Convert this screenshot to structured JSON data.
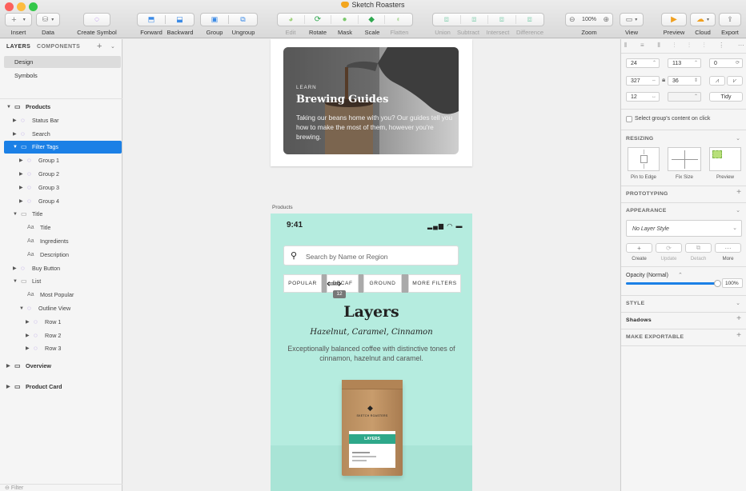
{
  "window": {
    "title": "Sketch Roasters"
  },
  "toolbar": {
    "insert": "Insert",
    "data": "Data",
    "create_symbol": "Create Symbol",
    "forward": "Forward",
    "backward": "Backward",
    "group": "Group",
    "ungroup": "Ungroup",
    "edit": "Edit",
    "rotate": "Rotate",
    "mask": "Mask",
    "scale": "Scale",
    "flatten": "Flatten",
    "union": "Union",
    "subtract": "Subtract",
    "intersect": "Intersect",
    "difference": "Difference",
    "zoom_label": "Zoom",
    "zoom_value": "100%",
    "view": "View",
    "preview": "Preview",
    "cloud": "Cloud",
    "export": "Export"
  },
  "left": {
    "tab_layers": "LAYERS",
    "tab_components": "COMPONENTS",
    "pages": [
      "Design",
      "Symbols"
    ],
    "layers": [
      {
        "label": "Products",
        "depth": 0,
        "kind": "artboard",
        "open": true
      },
      {
        "label": "Status Bar",
        "depth": 1,
        "kind": "symbol",
        "open": false
      },
      {
        "label": "Search",
        "depth": 1,
        "kind": "symbol",
        "open": false
      },
      {
        "label": "Filter Tags",
        "depth": 1,
        "kind": "folder",
        "open": true,
        "selected": true
      },
      {
        "label": "Group 1",
        "depth": 2,
        "kind": "symbol",
        "open": false
      },
      {
        "label": "Group 2",
        "depth": 2,
        "kind": "symbol",
        "open": false
      },
      {
        "label": "Group 3",
        "depth": 2,
        "kind": "symbol",
        "open": false
      },
      {
        "label": "Group 4",
        "depth": 2,
        "kind": "symbol",
        "open": false
      },
      {
        "label": "Title",
        "depth": 1,
        "kind": "folder",
        "open": true
      },
      {
        "label": "Title",
        "depth": 2,
        "kind": "text"
      },
      {
        "label": "Ingredients",
        "depth": 2,
        "kind": "text"
      },
      {
        "label": "Description",
        "depth": 2,
        "kind": "text"
      },
      {
        "label": "Buy Button",
        "depth": 1,
        "kind": "symbol",
        "open": false
      },
      {
        "label": "List",
        "depth": 1,
        "kind": "folder",
        "open": true
      },
      {
        "label": "Most Popular",
        "depth": 2,
        "kind": "text"
      },
      {
        "label": "Outline View",
        "depth": 2,
        "kind": "symbol",
        "open": true
      },
      {
        "label": "Row 1",
        "depth": 3,
        "kind": "symbol",
        "open": false
      },
      {
        "label": "Row 2",
        "depth": 3,
        "kind": "symbol",
        "open": false
      },
      {
        "label": "Row 3",
        "depth": 3,
        "kind": "symbol",
        "open": false
      },
      {
        "label": "Overview",
        "depth": 0,
        "kind": "artboard",
        "open": false
      },
      {
        "label": "Product Card",
        "depth": 0,
        "kind": "artboard",
        "open": false
      }
    ],
    "filter": "Filter"
  },
  "canvas": {
    "card": {
      "eyebrow": "LEARN",
      "title": "Brewing Guides",
      "body": "Taking our beans home with you? Our guides tell you how to make the most of them, however you're brewing."
    },
    "artboard_label": "Products",
    "phone": {
      "time": "9:41",
      "search_placeholder": "Search by Name or Region",
      "tags": [
        "POPULAR",
        "DECAF",
        "GROUND",
        "MORE FILTERS"
      ],
      "spacing_badge": "12",
      "title": "Layers",
      "ingredients": "Hazelnut, Caramel, Cinnamon",
      "description": "Exceptionally balanced coffee with distinctive tones of cinnamon, hazelnut and caramel.",
      "bag_label": "LAYERS",
      "brand": "SKETCH ROASTERS",
      "bg_color": "#b5ecdf"
    }
  },
  "right": {
    "x": "24",
    "y": "113",
    "rotation": "0",
    "w": "327",
    "h": "36",
    "spacing": "12",
    "tidy": "Tidy",
    "select_group_content": "Select group's content on click",
    "resizing": "RESIZING",
    "resize_labels": [
      "Pin to Edge",
      "Fix Size",
      "Preview"
    ],
    "prototyping": "PROTOTYPING",
    "appearance": "APPEARANCE",
    "layer_style": "No Layer Style",
    "style_actions": [
      "Create",
      "Update",
      "Detach",
      "More"
    ],
    "opacity_label": "Opacity (Normal)",
    "opacity_value": "100%",
    "opacity_fraction": 1.0,
    "style": "STYLE",
    "shadows": "Shadows",
    "make_exportable": "MAKE EXPORTABLE"
  }
}
